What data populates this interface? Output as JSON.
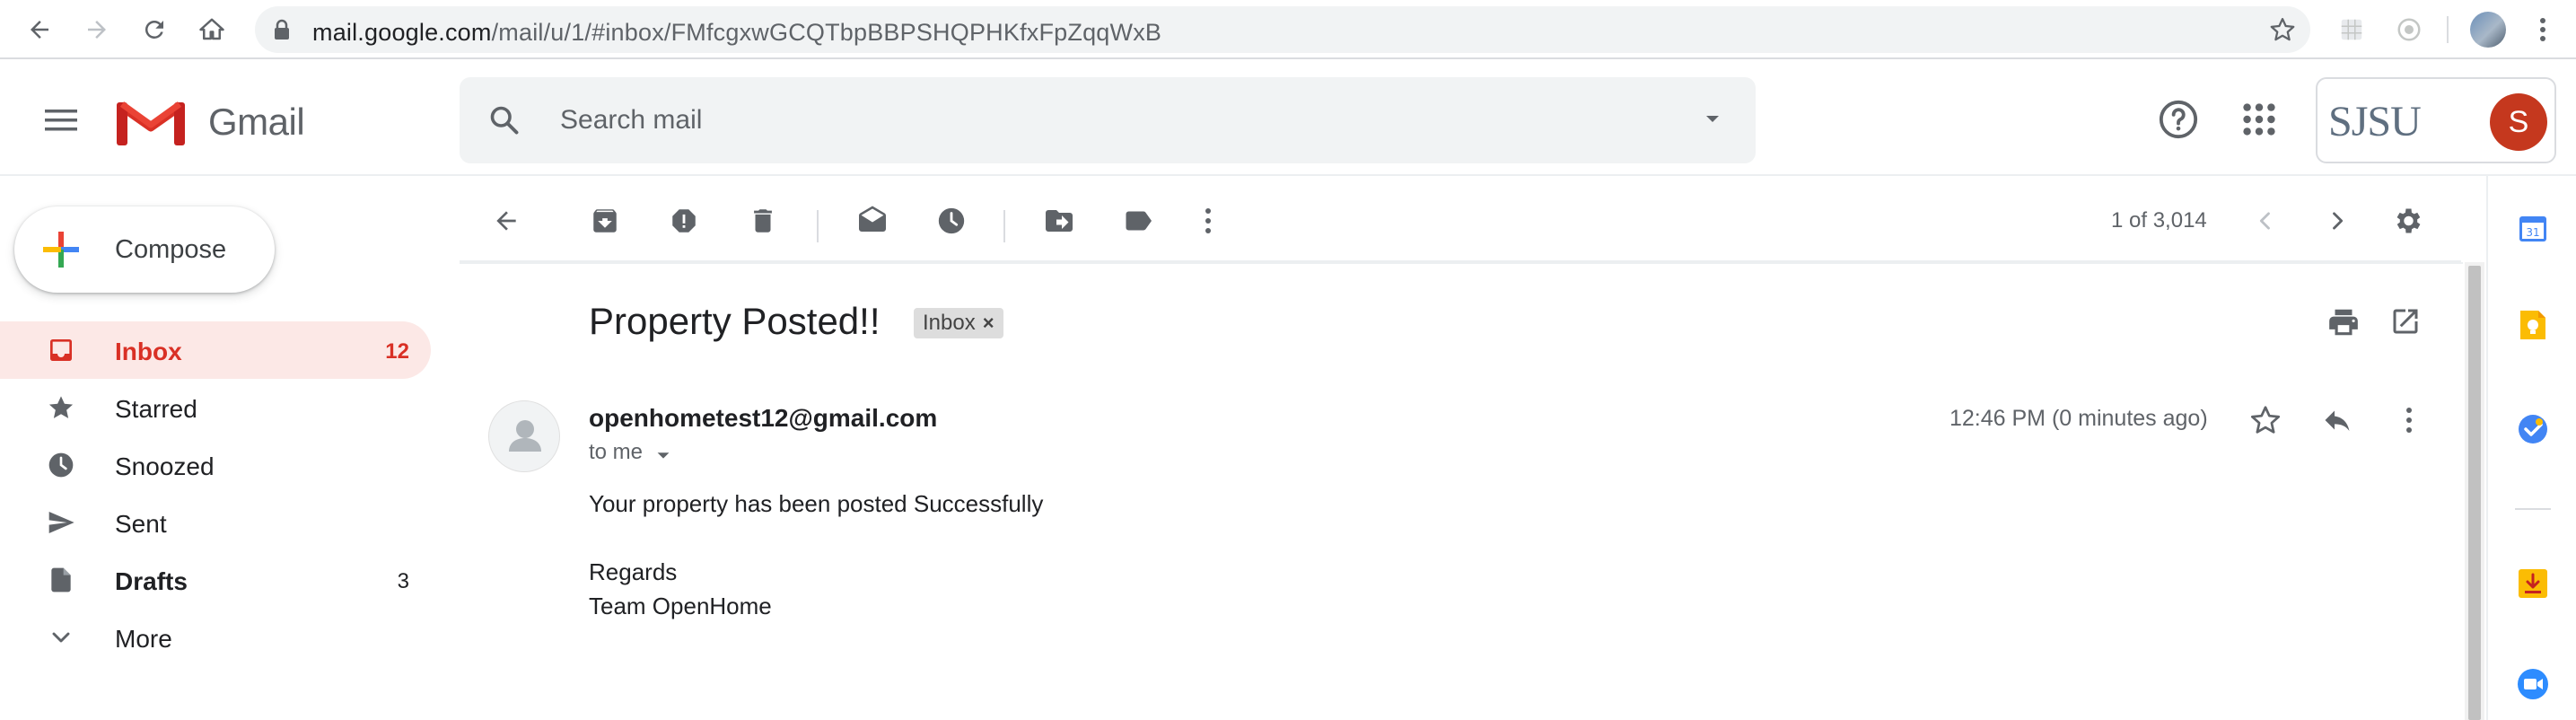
{
  "browser": {
    "url_host": "mail.google.com",
    "url_path": "/mail/u/1/#inbox/FMfcgxwGCQTbpBBPSHQPHKfxFpZqqWxB"
  },
  "header": {
    "app_name": "Gmail",
    "search_placeholder": "Search mail",
    "account_org": "SJSU",
    "avatar_initial": "S"
  },
  "sidebar": {
    "compose_label": "Compose",
    "items": [
      {
        "label": "Inbox",
        "count": "12",
        "icon": "inbox-icon"
      },
      {
        "label": "Starred",
        "count": "",
        "icon": "star-icon"
      },
      {
        "label": "Snoozed",
        "count": "",
        "icon": "clock-icon"
      },
      {
        "label": "Sent",
        "count": "",
        "icon": "send-icon"
      },
      {
        "label": "Drafts",
        "count": "3",
        "icon": "draft-icon"
      },
      {
        "label": "More",
        "count": "",
        "icon": "chevron-down-icon"
      }
    ]
  },
  "toolbar": {
    "pager": "1 of 3,014"
  },
  "message": {
    "subject": "Property Posted!!",
    "label": "Inbox",
    "sender": "openhometest12@gmail.com",
    "recipient": "to me",
    "time": "12:46 PM (0 minutes ago)",
    "body": [
      "Your property has been posted Successfully",
      "Regards",
      "Team OpenHome"
    ]
  },
  "colors": {
    "accent_red": "#d93025",
    "active_bg": "#fce8e6",
    "icon_gray": "#5f6368",
    "avatar_bg": "#c5381e"
  }
}
